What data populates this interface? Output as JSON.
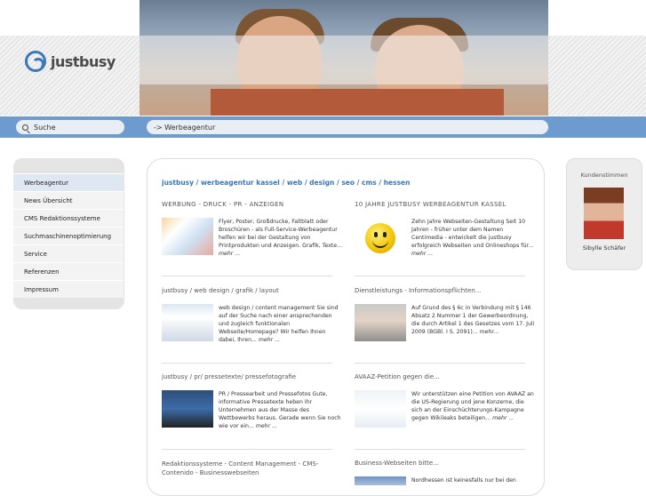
{
  "header": {
    "logo_text": "justbusy",
    "search_label": "Suche",
    "breadcrumb": "-> Werbeagentur"
  },
  "colors": {
    "accent": "#3a78b8",
    "navbar": "#6d9bd0",
    "sidebar_bg": "#e4e4e4"
  },
  "sidebar": {
    "items": [
      {
        "label": "Werbeagentur",
        "active": true
      },
      {
        "label": "News Übersicht",
        "active": false
      },
      {
        "label": "CMS Redaktionssysteme",
        "active": false
      },
      {
        "label": "Suchmaschinenoptimierung",
        "active": false
      },
      {
        "label": "Service",
        "active": false
      },
      {
        "label": "Referenzen",
        "active": false
      },
      {
        "label": "Impressum",
        "active": false
      }
    ]
  },
  "main": {
    "headline": "justbusy / werbeagentur kassel / web / design / seo / cms / hessen",
    "sections": [
      {
        "title": "WERBUNG - DRUCK - PR - ANZEIGEN",
        "text": "Flyer, Poster, Großdrucke, Faltblatt oder Broschüren - als Full-Service-Werbeagentur helfen wir bei der Gestaltung von Printprodukten und Anzeigen. Grafik, Texte...",
        "more": "mehr ..."
      },
      {
        "title": "10 JAHRE JUSTBUSY WERBEAGENTUR KASSEL",
        "text": "Zehn Jahre Webseiten-Gestaltung Seit 10 Jahren - früher unter dem Namen Centimedia - entwickelt die justbusy erfolgreich Webseiten und Onlineshops für...",
        "more": "mehr ..."
      },
      {
        "title": "justbusy / web design / grafik / layout",
        "text": "web design / content management Sie sind auf der Suche nach einer ansprechenden und zugleich funktionalen Webseite/Homepage? Wir helfen Ihnen dabei, Ihren...",
        "more": "mehr ..."
      },
      {
        "title": "Dienstleistungs - Informationspflichten...",
        "text": "Auf Grund des § 6c in Verbindung mit § 146 Absatz 2 Nummer 1 der Gewerbeordnung, die durch Artikel 1 des Gesetzes vom 17. Juli 2009 (BGBl. I S. 2091)...",
        "more": "mehr..."
      },
      {
        "title": "justbusy / pr/ pressetexte/ pressefotografie",
        "text": "PR / Pressearbeit und Pressefotos Gute, informative Pressetexte heben Ihr Unternehmen aus der Masse des Wettbewerbs heraus. Gerade wenn Sie noch wie vor ein...",
        "more": "mehr ..."
      },
      {
        "title": "AVAAZ-Petition gegen die...",
        "text": "Wir unterstützen eine Petition von AVAAZ an die US-Regierung und jene Konzerne, die sich an der Einschüchterungs-Kampagne gegen Wikileaks beteiligen...",
        "more": "mehr ..."
      },
      {
        "title": "Redaktionssysteme - Content Management - CMS-Contenido - Businesswebseiten",
        "text": "",
        "more": ""
      },
      {
        "title": "Business-Webseiten bitte...",
        "text": "Nordhessen ist keinesfalls nur bei den",
        "more": ""
      }
    ]
  },
  "testimonial": {
    "title": "Kundenstimmen",
    "name": "Sibylle Schäfer"
  }
}
